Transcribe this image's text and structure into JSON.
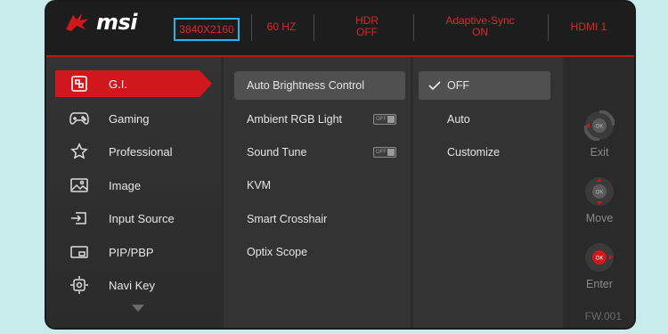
{
  "brand": {
    "logo_text": "msi",
    "accent": "#d0171c",
    "highlight": "#2bb4e6"
  },
  "status_bar": {
    "resolution": "3840X2160",
    "refresh_rate": "60 HZ",
    "hdr_label": "HDR",
    "hdr_value": "OFF",
    "sync_label": "Adaptive-Sync",
    "sync_value": "ON",
    "input": "HDMI 1"
  },
  "main_menu": {
    "items": [
      {
        "label": "G.I.",
        "icon": "gi-icon",
        "active": true
      },
      {
        "label": "Gaming",
        "icon": "gamepad-icon"
      },
      {
        "label": "Professional",
        "icon": "star-icon"
      },
      {
        "label": "Image",
        "icon": "image-icon"
      },
      {
        "label": "Input Source",
        "icon": "input-source-icon"
      },
      {
        "label": "PIP/PBP",
        "icon": "pip-icon"
      },
      {
        "label": "Navi Key",
        "icon": "navi-key-icon"
      }
    ]
  },
  "sub_menu": {
    "items": [
      {
        "label": "Auto Brightness Control",
        "selected": true
      },
      {
        "label": "Ambient RGB Light",
        "toggle": "OFF"
      },
      {
        "label": "Sound Tune",
        "toggle": "OFF"
      },
      {
        "label": "KVM"
      },
      {
        "label": "Smart Crosshair"
      },
      {
        "label": "Optix Scope"
      }
    ]
  },
  "options": {
    "items": [
      {
        "label": "OFF",
        "checked": true
      },
      {
        "label": "Auto"
      },
      {
        "label": "Customize"
      }
    ]
  },
  "controls": {
    "exit": "Exit",
    "move": "Move",
    "enter": "Enter",
    "ok": "OK"
  },
  "firmware": "FW.001"
}
